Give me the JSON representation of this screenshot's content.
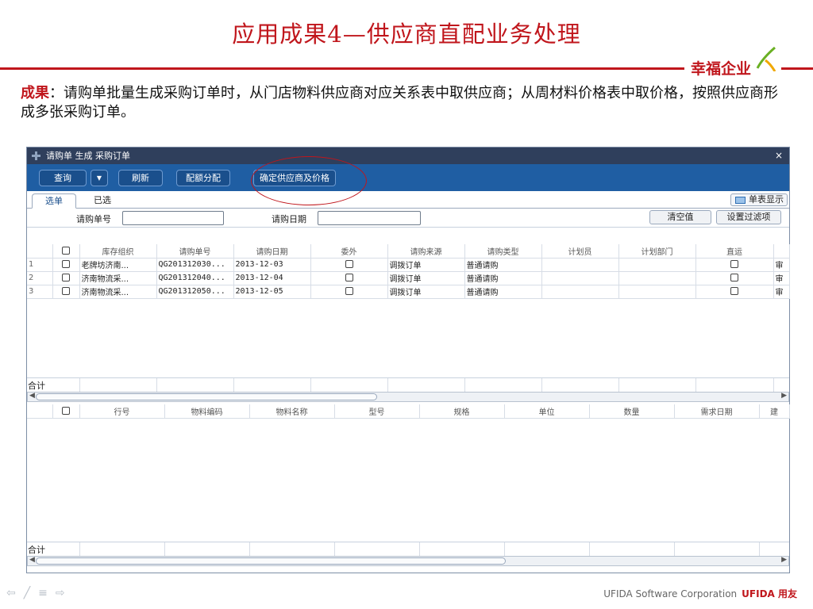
{
  "slide": {
    "title": "应用成果4—供应商直配业务处理",
    "logo_text": "幸福企业",
    "description_label": "成果",
    "description_sep": "：",
    "description_text": "请购单批量生成采购订单时，从门店物料供应商对应关系表中取供应商；从周材料价格表中取价格，按照供应商形成多张采购订单。"
  },
  "window": {
    "title": "请购单 生成 采购订单",
    "close": "×"
  },
  "toolbar": {
    "query": "查询",
    "dropdown": "▼",
    "refresh": "刷新",
    "allocate": "配额分配",
    "confirm_supplier_price": "确定供应商及价格"
  },
  "tabs": {
    "select": "选单",
    "selected": "已选",
    "single_view": "单表显示"
  },
  "filter": {
    "req_no_label": "请购单号",
    "req_no_value": "",
    "req_date_label": "请购日期",
    "req_date_value": "",
    "clear": "清空值",
    "set_filter": "设置过滤项"
  },
  "upper_grid": {
    "headers": [
      "库存组织",
      "请购单号",
      "请购日期",
      "委外",
      "请购来源",
      "请购类型",
      "计划员",
      "计划部门",
      "直运",
      "审"
    ],
    "rows": [
      {
        "n": "1",
        "org": "老牌坊济南...",
        "no": "QG201312030...",
        "date": "2013-12-03",
        "source": "调拨订单",
        "type": "普通请购",
        "tail": "审"
      },
      {
        "n": "2",
        "org": "济南物流采...",
        "no": "QG201312040...",
        "date": "2013-12-04",
        "source": "调拨订单",
        "type": "普通请购",
        "tail": "审"
      },
      {
        "n": "3",
        "org": "济南物流采...",
        "no": "QG201312050...",
        "date": "2013-12-05",
        "source": "调拨订单",
        "type": "普通请购",
        "tail": "审"
      }
    ],
    "total_label": "合计"
  },
  "lower_grid": {
    "headers": [
      "行号",
      "物料编码",
      "物料名称",
      "型号",
      "规格",
      "单位",
      "数量",
      "需求日期",
      "建"
    ],
    "total_label": "合计"
  },
  "footer": {
    "company": "UFIDA Software Corporation",
    "brand": "UFIDA 用友"
  },
  "colors": {
    "title_red": "#c0161c",
    "toolbar_blue": "#1f5ea3",
    "window_title": "#2f3f5c"
  }
}
